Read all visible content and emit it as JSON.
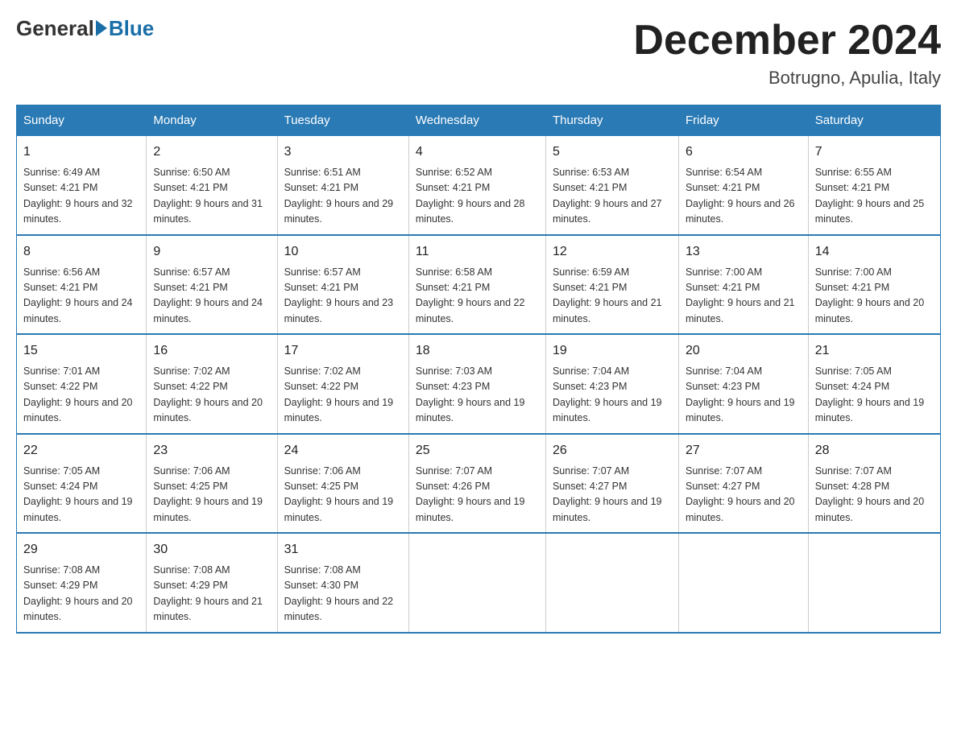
{
  "logo": {
    "general": "General",
    "blue": "Blue"
  },
  "title": "December 2024",
  "subtitle": "Botrugno, Apulia, Italy",
  "headers": [
    "Sunday",
    "Monday",
    "Tuesday",
    "Wednesday",
    "Thursday",
    "Friday",
    "Saturday"
  ],
  "weeks": [
    [
      {
        "day": "1",
        "sunrise": "6:49 AM",
        "sunset": "4:21 PM",
        "daylight": "9 hours and 32 minutes."
      },
      {
        "day": "2",
        "sunrise": "6:50 AM",
        "sunset": "4:21 PM",
        "daylight": "9 hours and 31 minutes."
      },
      {
        "day": "3",
        "sunrise": "6:51 AM",
        "sunset": "4:21 PM",
        "daylight": "9 hours and 29 minutes."
      },
      {
        "day": "4",
        "sunrise": "6:52 AM",
        "sunset": "4:21 PM",
        "daylight": "9 hours and 28 minutes."
      },
      {
        "day": "5",
        "sunrise": "6:53 AM",
        "sunset": "4:21 PM",
        "daylight": "9 hours and 27 minutes."
      },
      {
        "day": "6",
        "sunrise": "6:54 AM",
        "sunset": "4:21 PM",
        "daylight": "9 hours and 26 minutes."
      },
      {
        "day": "7",
        "sunrise": "6:55 AM",
        "sunset": "4:21 PM",
        "daylight": "9 hours and 25 minutes."
      }
    ],
    [
      {
        "day": "8",
        "sunrise": "6:56 AM",
        "sunset": "4:21 PM",
        "daylight": "9 hours and 24 minutes."
      },
      {
        "day": "9",
        "sunrise": "6:57 AM",
        "sunset": "4:21 PM",
        "daylight": "9 hours and 24 minutes."
      },
      {
        "day": "10",
        "sunrise": "6:57 AM",
        "sunset": "4:21 PM",
        "daylight": "9 hours and 23 minutes."
      },
      {
        "day": "11",
        "sunrise": "6:58 AM",
        "sunset": "4:21 PM",
        "daylight": "9 hours and 22 minutes."
      },
      {
        "day": "12",
        "sunrise": "6:59 AM",
        "sunset": "4:21 PM",
        "daylight": "9 hours and 21 minutes."
      },
      {
        "day": "13",
        "sunrise": "7:00 AM",
        "sunset": "4:21 PM",
        "daylight": "9 hours and 21 minutes."
      },
      {
        "day": "14",
        "sunrise": "7:00 AM",
        "sunset": "4:21 PM",
        "daylight": "9 hours and 20 minutes."
      }
    ],
    [
      {
        "day": "15",
        "sunrise": "7:01 AM",
        "sunset": "4:22 PM",
        "daylight": "9 hours and 20 minutes."
      },
      {
        "day": "16",
        "sunrise": "7:02 AM",
        "sunset": "4:22 PM",
        "daylight": "9 hours and 20 minutes."
      },
      {
        "day": "17",
        "sunrise": "7:02 AM",
        "sunset": "4:22 PM",
        "daylight": "9 hours and 19 minutes."
      },
      {
        "day": "18",
        "sunrise": "7:03 AM",
        "sunset": "4:23 PM",
        "daylight": "9 hours and 19 minutes."
      },
      {
        "day": "19",
        "sunrise": "7:04 AM",
        "sunset": "4:23 PM",
        "daylight": "9 hours and 19 minutes."
      },
      {
        "day": "20",
        "sunrise": "7:04 AM",
        "sunset": "4:23 PM",
        "daylight": "9 hours and 19 minutes."
      },
      {
        "day": "21",
        "sunrise": "7:05 AM",
        "sunset": "4:24 PM",
        "daylight": "9 hours and 19 minutes."
      }
    ],
    [
      {
        "day": "22",
        "sunrise": "7:05 AM",
        "sunset": "4:24 PM",
        "daylight": "9 hours and 19 minutes."
      },
      {
        "day": "23",
        "sunrise": "7:06 AM",
        "sunset": "4:25 PM",
        "daylight": "9 hours and 19 minutes."
      },
      {
        "day": "24",
        "sunrise": "7:06 AM",
        "sunset": "4:25 PM",
        "daylight": "9 hours and 19 minutes."
      },
      {
        "day": "25",
        "sunrise": "7:07 AM",
        "sunset": "4:26 PM",
        "daylight": "9 hours and 19 minutes."
      },
      {
        "day": "26",
        "sunrise": "7:07 AM",
        "sunset": "4:27 PM",
        "daylight": "9 hours and 19 minutes."
      },
      {
        "day": "27",
        "sunrise": "7:07 AM",
        "sunset": "4:27 PM",
        "daylight": "9 hours and 20 minutes."
      },
      {
        "day": "28",
        "sunrise": "7:07 AM",
        "sunset": "4:28 PM",
        "daylight": "9 hours and 20 minutes."
      }
    ],
    [
      {
        "day": "29",
        "sunrise": "7:08 AM",
        "sunset": "4:29 PM",
        "daylight": "9 hours and 20 minutes."
      },
      {
        "day": "30",
        "sunrise": "7:08 AM",
        "sunset": "4:29 PM",
        "daylight": "9 hours and 21 minutes."
      },
      {
        "day": "31",
        "sunrise": "7:08 AM",
        "sunset": "4:30 PM",
        "daylight": "9 hours and 22 minutes."
      },
      null,
      null,
      null,
      null
    ]
  ]
}
